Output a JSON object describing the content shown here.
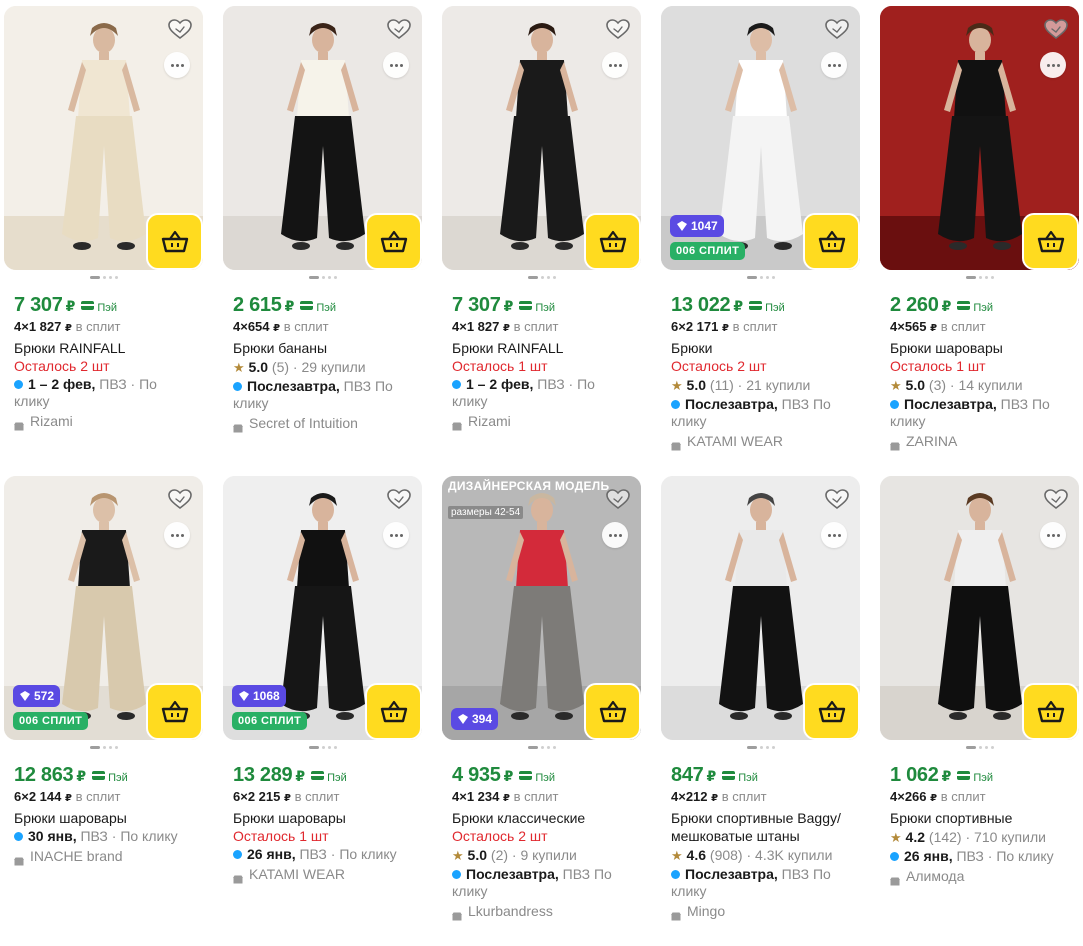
{
  "colors": {
    "price": "#1f8a3d",
    "stock": "#e0282e",
    "cart": "#ffdb1f",
    "points": "#5a4ae3",
    "split": "#29b065",
    "delivery_dot": "#1aa3ff"
  },
  "icons": {
    "favorite": "heart-outline-icon",
    "more": "ellipsis-icon",
    "cart": "basket-icon",
    "points": "points-icon",
    "pay": "card-icon",
    "shop": "shop-icon",
    "star": "star-icon"
  },
  "currency": "₽",
  "pay_label": "Пэй",
  "split_suffix": "в сплит",
  "delivery_suffix": "ПВЗ",
  "products": [
    {
      "price": "7 307",
      "split": "4×1 827",
      "title": "Брюки RAINFALL",
      "stock": "Осталось 2 шт",
      "delivery_date": "1 – 2 фев,",
      "delivery_rest": "ПВЗ · По клику",
      "seller": "Rizami"
    },
    {
      "price": "2 615",
      "split": "4×654",
      "title": "Брюки бананы",
      "rating": "5.0",
      "rating_rest": "(5) · 29 купили",
      "delivery_date": "Послезавтра,",
      "delivery_rest": "ПВЗ По клику",
      "seller": "Secret of Intuition"
    },
    {
      "price": "7 307",
      "split": "4×1 827",
      "title": "Брюки RAINFALL",
      "stock": "Осталось 1 шт",
      "delivery_date": "1 – 2 фев,",
      "delivery_rest": "ПВЗ · По клику",
      "seller": "Rizami"
    },
    {
      "price": "13 022",
      "split": "6×2 171",
      "title": "Брюки",
      "stock": "Осталось 2 шт",
      "rating": "5.0",
      "rating_rest": "(11) · 21 купили",
      "delivery_date": "Послезавтра,",
      "delivery_rest": "ПВЗ По клику",
      "seller": "KATAMI WEAR",
      "points": "1047",
      "split_badge": "006 СПЛИТ"
    },
    {
      "price": "2 260",
      "split": "4×565",
      "title": "Брюки шаровары",
      "stock": "Осталось 1 шт",
      "rating": "5.0",
      "rating_rest": "(3) · 14 купили",
      "delivery_date": "Послезавтра,",
      "delivery_rest": "ПВЗ По клику",
      "seller": "ZARINA"
    },
    {
      "price": "12 863",
      "split": "6×2 144",
      "title": "Брюки шаровары",
      "delivery_date": "30 янв,",
      "delivery_rest": "ПВЗ · По клику",
      "seller": "INACHE brand",
      "points": "572",
      "split_badge": "006 СПЛИТ"
    },
    {
      "price": "13 289",
      "split": "6×2 215",
      "title": "Брюки шаровары",
      "stock": "Осталось 1 шт",
      "delivery_date": "26 янв,",
      "delivery_rest": "ПВЗ · По клику",
      "seller": "KATAMI WEAR",
      "points": "1068",
      "split_badge": "006 СПЛИТ"
    },
    {
      "price": "4 935",
      "split": "4×1 234",
      "title": "Брюки классические",
      "stock": "Осталось 2 шт",
      "rating": "5.0",
      "rating_rest": "(2) · 9 купили",
      "delivery_date": "Послезавтра,",
      "delivery_rest": "ПВЗ По клику",
      "seller": "Lkurbandress",
      "points": "394",
      "promo_title": "ДИЗАЙНЕРСКАЯ МОДЕЛЬ",
      "promo_sub": "размеры 42-54"
    },
    {
      "price": "847",
      "split": "4×212",
      "title": "Брюки спортивные Baggy/ мешковатые штаны",
      "rating": "4.6",
      "rating_rest": "(908) · 4.3K купили",
      "delivery_date": "Послезавтра,",
      "delivery_rest": "ПВЗ По клику",
      "seller": "Mingo"
    },
    {
      "price": "1 062",
      "split": "4×266",
      "title": "Брюки спортивные",
      "rating": "4.2",
      "rating_rest": "(142) · 710 купили",
      "delivery_date": "26 янв,",
      "delivery_rest": "ПВЗ · По клику",
      "seller": "Алимода"
    }
  ]
}
